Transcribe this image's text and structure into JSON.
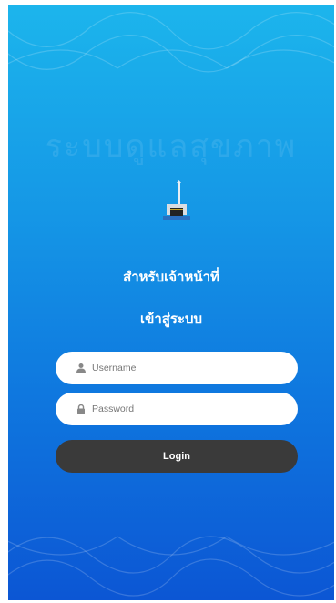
{
  "header": {
    "watermark_text": "ระบบดูแลสุขภาพ",
    "subtitle": "สำหรับเจ้าหน้าที่",
    "title": "เข้าสู่ระบบ"
  },
  "form": {
    "username_placeholder": "Username",
    "password_placeholder": "Password",
    "login_label": "Login"
  },
  "icons": {
    "logo": "crescent-kaaba-logo-icon",
    "username": "user-icon",
    "password": "lock-icon"
  },
  "colors": {
    "gradient_top": "#1cb5ec",
    "gradient_bottom": "#0c56d4",
    "button": "#3a3a3a",
    "logo_crescent": "#f2c21a"
  }
}
